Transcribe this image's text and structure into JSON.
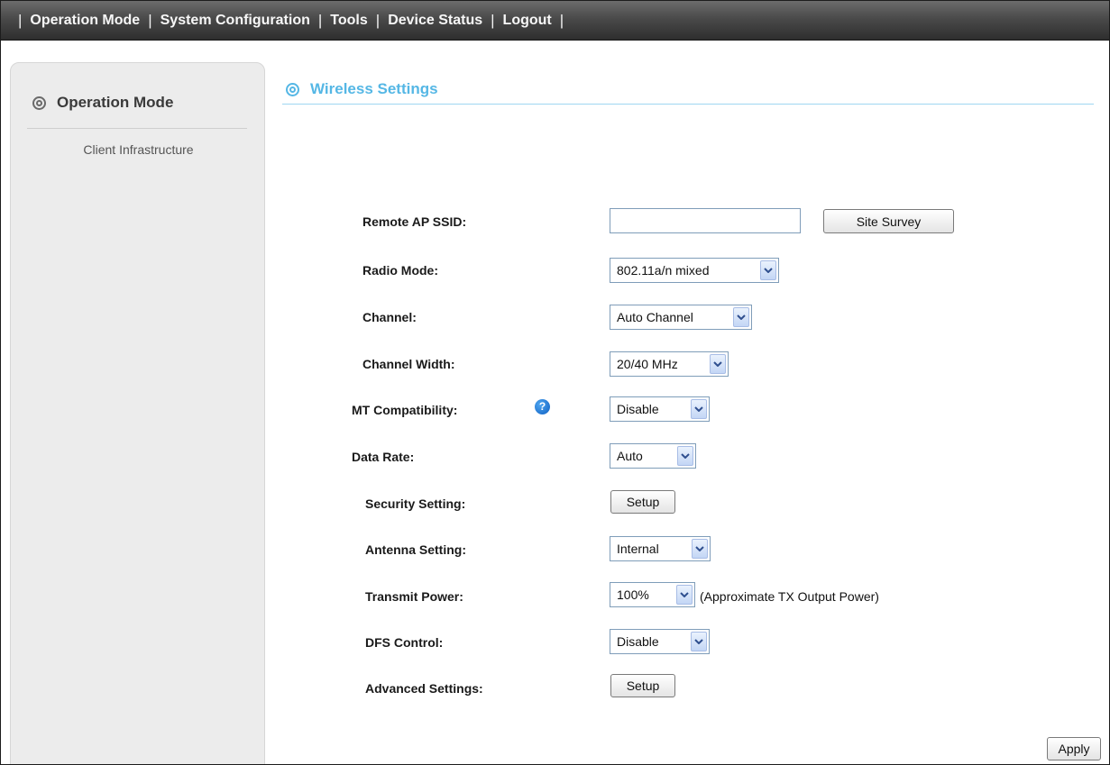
{
  "nav": {
    "items": [
      "Operation Mode",
      "System Configuration",
      "Tools",
      "Device Status",
      "Logout"
    ]
  },
  "sidebar": {
    "title": "Operation Mode",
    "item": "Client Infrastructure"
  },
  "section": {
    "title": "Wireless Settings"
  },
  "form": {
    "ssid_label": "Remote AP SSID:",
    "ssid_value": "",
    "site_survey_label": "Site Survey",
    "radio_mode_label": "Radio Mode:",
    "radio_mode_value": "802.11a/n mixed",
    "channel_label": "Channel:",
    "channel_value": "Auto Channel",
    "channel_width_label": "Channel Width:",
    "channel_width_value": "20/40 MHz",
    "mt_label": "MT Compatibility:",
    "mt_value": "Disable",
    "data_rate_label": "Data Rate:",
    "data_rate_value": "Auto",
    "security_label": "Security Setting:",
    "security_button": "Setup",
    "antenna_label": "Antenna Setting:",
    "antenna_value": "Internal",
    "tx_power_label": "Transmit Power:",
    "tx_power_value": "100%",
    "tx_power_note": "(Approximate TX Output Power)",
    "dfs_label": "DFS Control:",
    "dfs_value": "Disable",
    "advanced_label": "Advanced Settings:",
    "advanced_button": "Setup",
    "apply_label": "Apply"
  },
  "colors": {
    "accent": "#55b7e5",
    "nav_bg": "#3c3c3c",
    "sidebar_bg": "#ececec"
  },
  "icons": {
    "section": "target-icon",
    "help": "help-icon",
    "dropdown": "chevron-down-icon"
  }
}
